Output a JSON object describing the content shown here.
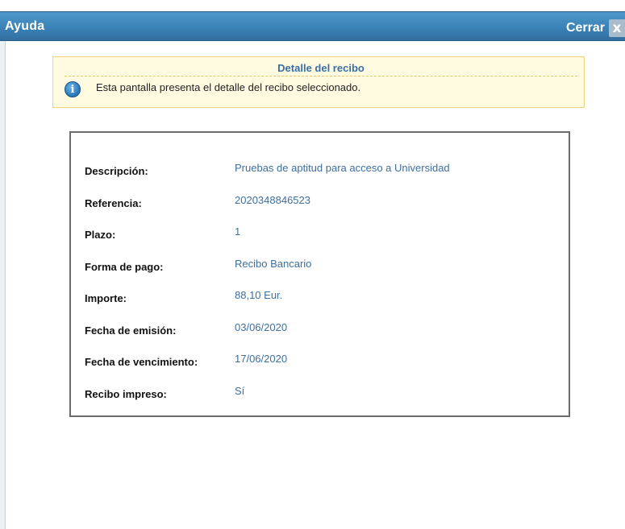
{
  "header": {
    "title": "Ayuda",
    "close_label": "Cerrar",
    "close_icon": "close-icon",
    "close_glyph": "x"
  },
  "info": {
    "title": "Detalle del recibo",
    "icon": "info-icon",
    "icon_glyph": "i",
    "text": "Esta pantalla presenta el detalle del recibo seleccionado."
  },
  "detail": {
    "rows": [
      {
        "label": "Descripción:",
        "value": "Pruebas de aptitud para acceso a Universidad"
      },
      {
        "label": "Referencia:",
        "value": "2020348846523"
      },
      {
        "label": "Plazo:",
        "value": "1"
      },
      {
        "label": "Forma de pago:",
        "value": "Recibo Bancario"
      },
      {
        "label": "Importe:",
        "value": "88,10 Eur."
      },
      {
        "label": "Fecha de emisión:",
        "value": "03/06/2020"
      },
      {
        "label": "Fecha de vencimiento:",
        "value": "17/06/2020"
      },
      {
        "label": "Recibo impreso:",
        "value": "Sí"
      }
    ]
  },
  "colors": {
    "header_bg": "#3b82b6",
    "info_bg": "#fffbe1",
    "info_border": "#f0d37a",
    "value_text": "#3d6fa0"
  }
}
